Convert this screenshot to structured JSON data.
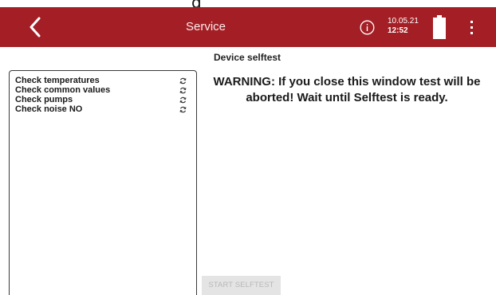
{
  "page_top_fragment": "g",
  "appbar": {
    "title": "Service",
    "date": "10.05.21",
    "time": "12:52",
    "back_icon": "chevron-left-icon",
    "info_icon": "info-circle-icon",
    "battery_icon": "battery-full-icon",
    "menu_icon": "more-vertical-icon",
    "color": "#a31f25"
  },
  "selftest": {
    "heading": "Device selftest",
    "checks": [
      {
        "label": "Check temperatures",
        "status_icon": "refresh-icon"
      },
      {
        "label": "Check common values",
        "status_icon": "refresh-icon"
      },
      {
        "label": "Check pumps",
        "status_icon": "refresh-icon"
      },
      {
        "label": "Check noise NO",
        "status_icon": "refresh-icon"
      }
    ],
    "warning": "WARNING: If you close this window test will be aborted! Wait until Selftest is ready.",
    "start_button": "START SELFTEST"
  }
}
